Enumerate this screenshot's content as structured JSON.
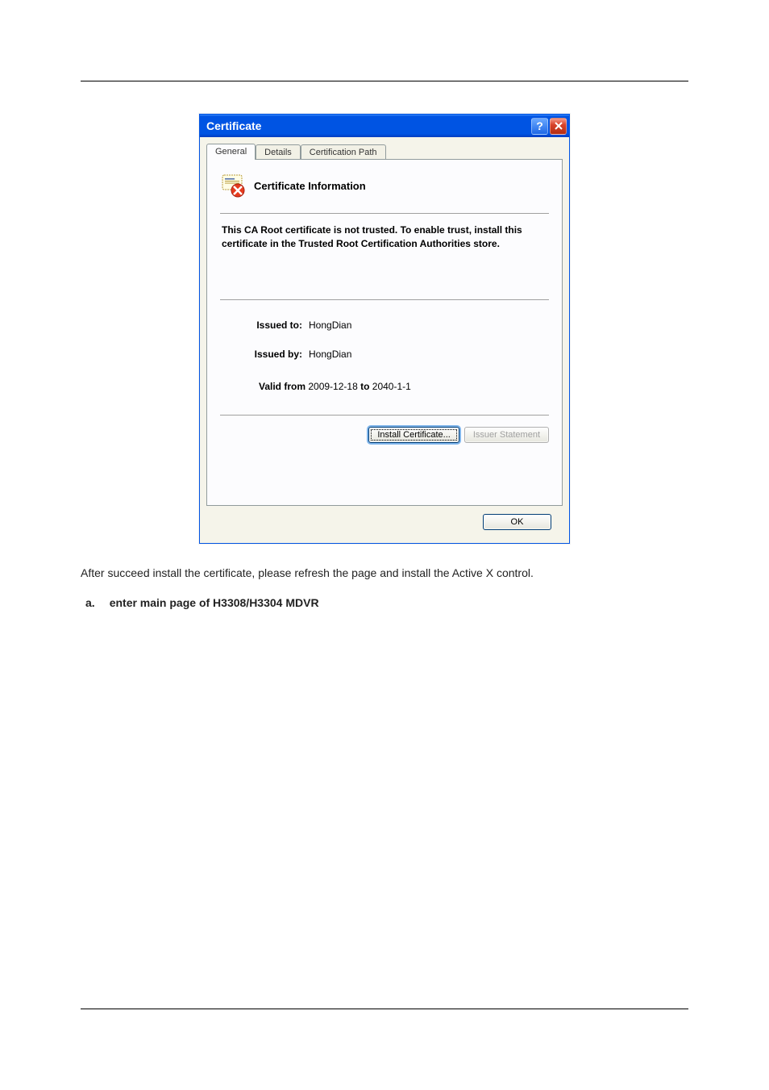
{
  "dialog": {
    "title": "Certificate",
    "tabs": {
      "general": "General",
      "details": "Details",
      "cert_path": "Certification Path"
    },
    "cert_info_heading": "Certificate Information",
    "cert_warning": "This CA Root certificate is not trusted. To enable trust, install this certificate in the Trusted Root Certification Authorities store.",
    "issued_to_label": "Issued to:",
    "issued_to_value": "HongDian",
    "issued_by_label": "Issued by:",
    "issued_by_value": "HongDian",
    "valid_from_label": "Valid from",
    "valid_from_value": "2009-12-18",
    "valid_to_label": "to",
    "valid_to_value": "2040-1-1",
    "install_button": "Install Certificate...",
    "issuer_button": "Issuer Statement",
    "ok_button": "OK"
  },
  "document": {
    "after_text": "After succeed install the certificate, please refresh the page and install the Active X control.",
    "list_marker": "a.",
    "list_text": "enter main page of H3308/H3304 MDVR"
  }
}
